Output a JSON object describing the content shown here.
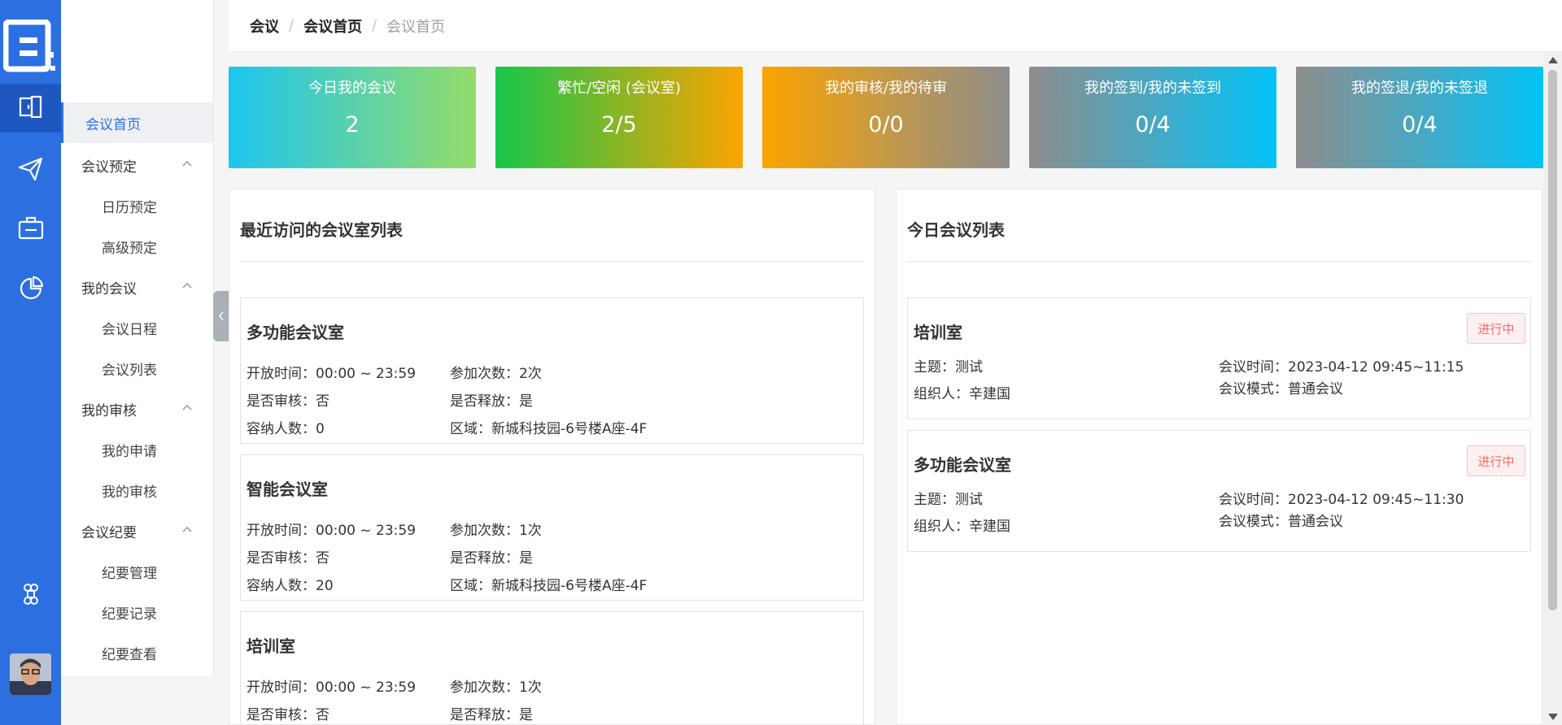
{
  "breadcrumb": [
    "会议",
    "会议首页",
    "会议首页"
  ],
  "sidebar": {
    "items": [
      {
        "label": "会议首页",
        "active": true
      },
      {
        "label": "会议预定"
      },
      {
        "label": "日历预定"
      },
      {
        "label": "高级预定"
      },
      {
        "label": "我的会议"
      },
      {
        "label": "会议日程"
      },
      {
        "label": "会议列表"
      },
      {
        "label": "我的审核"
      },
      {
        "label": "我的申请"
      },
      {
        "label": "我的审核"
      },
      {
        "label": "会议纪要"
      },
      {
        "label": "纪要管理"
      },
      {
        "label": "纪要记录"
      },
      {
        "label": "纪要查看"
      }
    ]
  },
  "stats": [
    {
      "label": "今日我的会议",
      "value": "2"
    },
    {
      "label": "繁忙/空闲 (会议室)",
      "value": "2/5"
    },
    {
      "label": "我的审核/我的待审",
      "value": "0/0"
    },
    {
      "label": "我的签到/我的未签到",
      "value": "0/4"
    },
    {
      "label": "我的签退/我的未签退",
      "value": "0/4"
    }
  ],
  "recent": {
    "title": "最近访问的会议室列表",
    "rooms": [
      {
        "name": "多功能会议室",
        "open": "开放时间：00:00 ~ 23:59",
        "count": "参加次数：2次",
        "audit": "是否审核：否",
        "release": "是否释放：是",
        "capacity": "容纳人数：0",
        "area": "区域：新城科技园-6号楼A座-4F"
      },
      {
        "name": "智能会议室",
        "open": "开放时间：00:00 ~ 23:59",
        "count": "参加次数：1次",
        "audit": "是否审核：否",
        "release": "是否释放：是",
        "capacity": "容纳人数：20",
        "area": "区域：新城科技园-6号楼A座-4F"
      },
      {
        "name": "培训室",
        "open": "开放时间：00:00 ~ 23:59",
        "count": "参加次数：1次",
        "audit": "是否审核：否",
        "release": "是否释放：是"
      }
    ]
  },
  "today": {
    "title": "今日会议列表",
    "meetings": [
      {
        "room": "培训室",
        "status": "进行中",
        "topic": "主题：测试",
        "time": "会议时间：2023-04-12 09:45~11:15",
        "organizer": "组织人：辛建国",
        "mode": "会议模式：普通会议"
      },
      {
        "room": "多功能会议室",
        "status": "进行中",
        "topic": "主题：测试",
        "time": "会议时间：2023-04-12 09:45~11:30",
        "organizer": "组织人：辛建国",
        "mode": "会议模式：普通会议"
      }
    ]
  },
  "icons": {
    "rail": [
      "logo-icon",
      "meeting-room-icon",
      "send-icon",
      "briefcase-icon",
      "pie-chart-icon",
      "command-icon"
    ],
    "chevron": "chevron-up-icon"
  },
  "colors": {
    "rail": "#2b6fe0",
    "accent": "#2b6fe0",
    "status": "#f56c6c"
  }
}
